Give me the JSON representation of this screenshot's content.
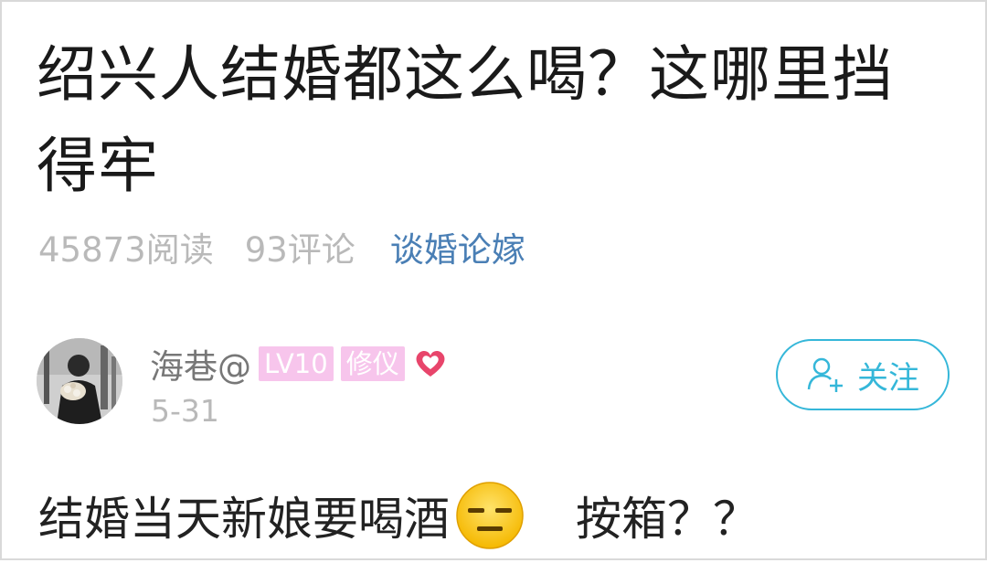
{
  "post": {
    "title": "绍兴人结婚都这么喝？这哪里挡得牢",
    "reads": "45873阅读",
    "comments": "93评论",
    "category": "谈婚论嫁"
  },
  "author": {
    "name": "海巷@",
    "level_badge": "LV10",
    "role_badge": "修仪",
    "date": "5-31"
  },
  "follow": {
    "label": "关注"
  },
  "body": {
    "text_before_emoji": "结婚当天新娘要喝酒",
    "emoji": "expressionless-face-icon",
    "text_after_emoji": "按箱？？"
  },
  "colors": {
    "accent": "#35b7d9",
    "category_link": "#4a7fb5",
    "badge_pink": "#f7c5ec",
    "heart_red": "#e8456b"
  }
}
